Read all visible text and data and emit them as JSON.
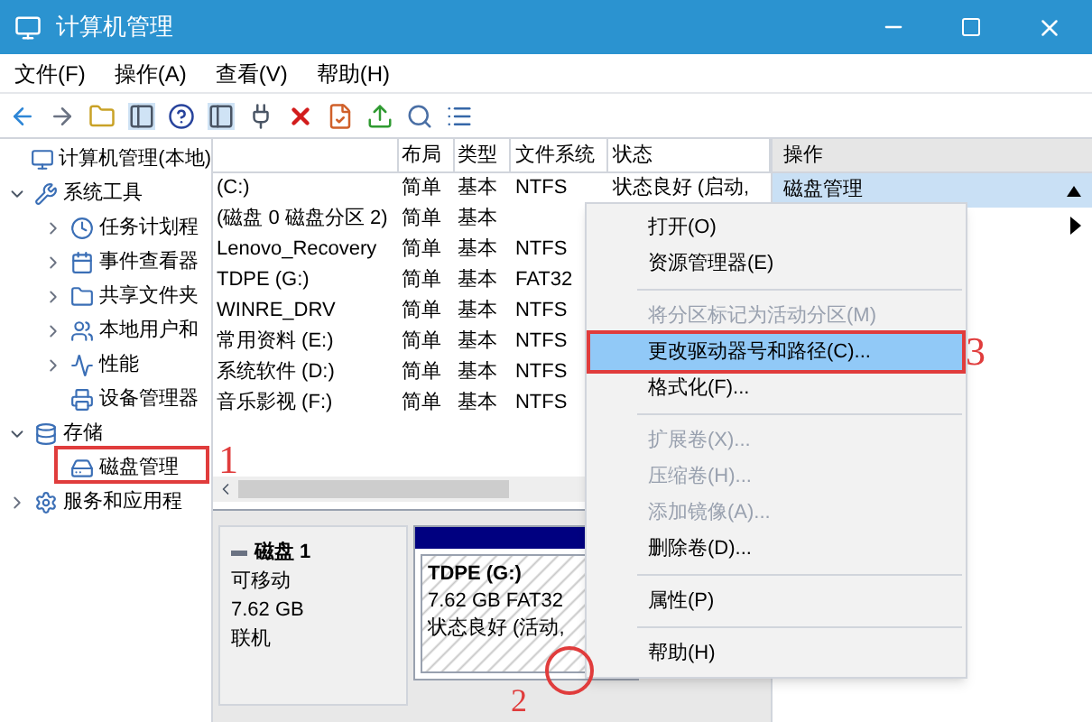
{
  "window": {
    "title": "计算机管理"
  },
  "menu_bar": [
    "文件(F)",
    "操作(A)",
    "查看(V)",
    "帮助(H)"
  ],
  "tree": [
    {
      "label": "计算机管理(本地)",
      "children": [
        {
          "label": "系统工具",
          "expanded": true,
          "children": [
            {
              "label": "任务计划程",
              "expanded": false
            },
            {
              "label": "事件查看器",
              "expanded": false
            },
            {
              "label": "共享文件夹",
              "expanded": false
            },
            {
              "label": "本地用户和",
              "expanded": false
            },
            {
              "label": "性能",
              "expanded": false
            },
            {
              "label": "设备管理器"
            }
          ]
        },
        {
          "label": "存储",
          "expanded": true,
          "children": [
            {
              "label": "磁盘管理"
            }
          ]
        },
        {
          "label": "服务和应用程",
          "expanded": false
        }
      ]
    }
  ],
  "table": {
    "columns": [
      "",
      "布局",
      "类型",
      "文件系统",
      "状态"
    ],
    "rows": [
      [
        "(C:)",
        "简单",
        "基本",
        "NTFS",
        "状态良好 (启动,"
      ],
      [
        "(磁盘 0 磁盘分区 2)",
        "简单",
        "基本",
        "",
        ""
      ],
      [
        "Lenovo_Recovery",
        "简单",
        "基本",
        "NTFS",
        ""
      ],
      [
        "TDPE (G:)",
        "简单",
        "基本",
        "FAT32",
        ""
      ],
      [
        "WINRE_DRV",
        "简单",
        "基本",
        "NTFS",
        ""
      ],
      [
        "常用资料 (E:)",
        "简单",
        "基本",
        "NTFS",
        ""
      ],
      [
        "系统软件 (D:)",
        "简单",
        "基本",
        "NTFS",
        ""
      ],
      [
        "音乐影视 (F:)",
        "简单",
        "基本",
        "NTFS",
        ""
      ]
    ]
  },
  "disk": {
    "name": "磁盘 1",
    "type": "可移动",
    "size": "7.62 GB",
    "status": "联机",
    "partition": {
      "name": "TDPE (G:)",
      "info": "7.62 GB FAT32",
      "status": "状态良好 (活动,"
    }
  },
  "actions": {
    "header": "操作",
    "items": [
      {
        "label": "磁盘管理",
        "selected": true
      }
    ]
  },
  "context_menu": [
    {
      "kind": "item",
      "label": "打开(O)",
      "disabled": false,
      "selected": false
    },
    {
      "kind": "item",
      "label": "资源管理器(E)",
      "disabled": false,
      "selected": false
    },
    {
      "kind": "separator"
    },
    {
      "kind": "item",
      "label": "将分区标记为活动分区(M)",
      "disabled": true,
      "selected": false
    },
    {
      "kind": "item",
      "label": "更改驱动器号和路径(C)...",
      "disabled": false,
      "selected": true
    },
    {
      "kind": "item",
      "label": "格式化(F)...",
      "disabled": false,
      "selected": false
    },
    {
      "kind": "separator"
    },
    {
      "kind": "item",
      "label": "扩展卷(X)...",
      "disabled": true,
      "selected": false
    },
    {
      "kind": "item",
      "label": "压缩卷(H)...",
      "disabled": true,
      "selected": false
    },
    {
      "kind": "item",
      "label": "添加镜像(A)...",
      "disabled": true,
      "selected": false
    },
    {
      "kind": "item",
      "label": "删除卷(D)...",
      "disabled": false,
      "selected": false
    },
    {
      "kind": "separator"
    },
    {
      "kind": "item",
      "label": "属性(P)",
      "disabled": false,
      "selected": false
    },
    {
      "kind": "separator"
    },
    {
      "kind": "item",
      "label": "帮助(H)",
      "disabled": false,
      "selected": false
    }
  ],
  "annotations": [
    "1",
    "2",
    "3"
  ]
}
